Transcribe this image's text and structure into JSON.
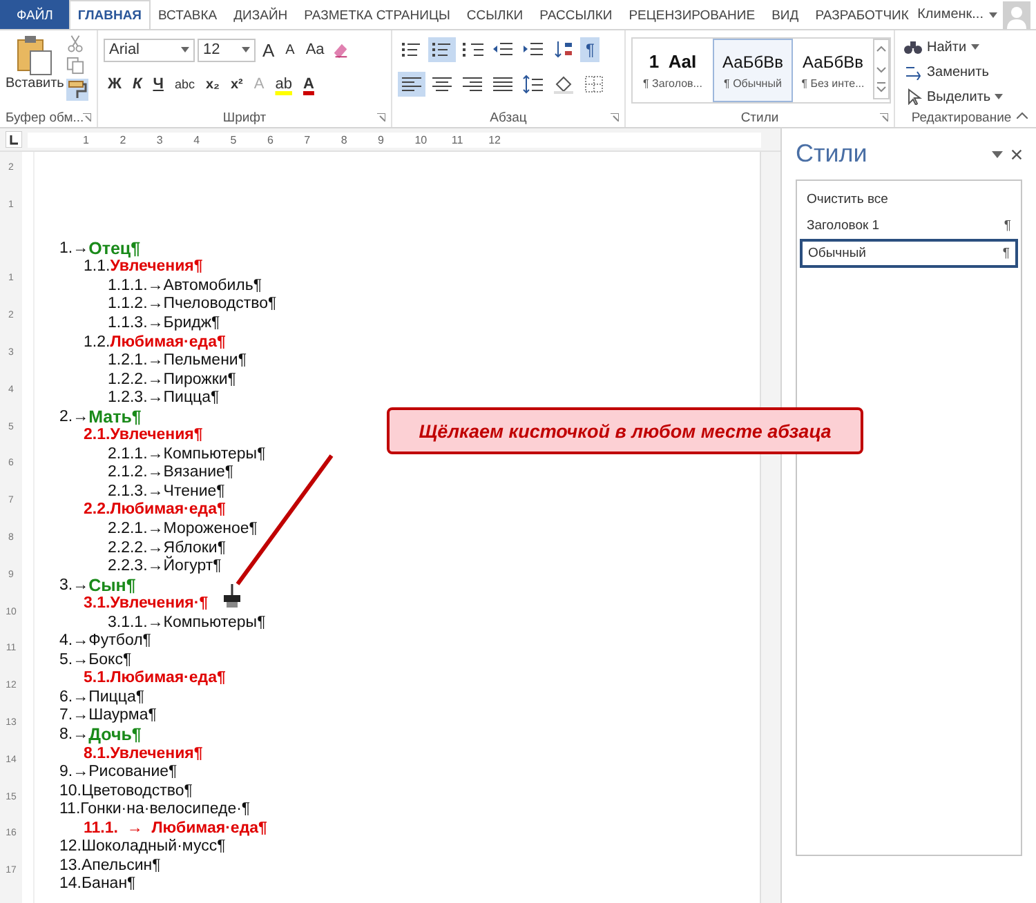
{
  "tabs": [
    {
      "label": "ФАЙЛ",
      "kind": "file",
      "selected": false
    },
    {
      "label": "ГЛАВНАЯ",
      "kind": "tab",
      "selected": true
    },
    {
      "label": "ВСТАВКА",
      "kind": "tab",
      "selected": false
    },
    {
      "label": "ДИЗАЙН",
      "kind": "tab",
      "selected": false
    },
    {
      "label": "РАЗМЕТКА СТРАНИЦЫ",
      "kind": "tab",
      "selected": false
    },
    {
      "label": "ССЫЛКИ",
      "kind": "tab",
      "selected": false
    },
    {
      "label": "РАССЫЛКИ",
      "kind": "tab",
      "selected": false
    },
    {
      "label": "РЕЦЕНЗИРОВАНИЕ",
      "kind": "tab",
      "selected": false
    },
    {
      "label": "ВИД",
      "kind": "tab",
      "selected": false
    },
    {
      "label": "РАЗРАБОТЧИК",
      "kind": "tab",
      "selected": false
    }
  ],
  "user": {
    "name": "Клименк..."
  },
  "clipboard": {
    "label": "Буфер обм...",
    "paste": "Вставить",
    "format_painter_on": true
  },
  "font": {
    "label": "Шрифт",
    "family": "Arial",
    "size": "12",
    "case_button": "Aa",
    "effects_letter": "A",
    "highlight_letters": "ab",
    "color_letter": "A",
    "format_buttons": [
      {
        "kind": "bold",
        "label": "Ж"
      },
      {
        "kind": "italic",
        "label": "К"
      },
      {
        "kind": "underline",
        "label": "Ч"
      },
      {
        "kind": "strike",
        "label": "abc"
      },
      {
        "kind": "sub",
        "label": "x₂"
      },
      {
        "kind": "sup",
        "label": "x²"
      }
    ],
    "size_buttons": [
      {
        "kind": "grow",
        "label": "A"
      },
      {
        "kind": "shrink",
        "label": "A"
      }
    ]
  },
  "paragraph": {
    "label": "Абзац",
    "row_1": [
      {
        "kind": "bullets",
        "selected": false
      },
      {
        "kind": "numbering",
        "selected": true
      },
      {
        "kind": "multilevel",
        "selected": false
      },
      {
        "kind": "outdent",
        "selected": false
      },
      {
        "kind": "indent",
        "selected": false
      },
      {
        "kind": "sort",
        "selected": false
      },
      {
        "kind": "marks",
        "selected": true,
        "label": "¶"
      }
    ],
    "row_2": [
      {
        "kind": "left",
        "selected": true
      },
      {
        "kind": "center",
        "selected": false
      },
      {
        "kind": "right",
        "selected": false
      },
      {
        "kind": "justify",
        "selected": false
      },
      {
        "kind": "spacing",
        "selected": false
      },
      {
        "kind": "shading",
        "selected": false
      },
      {
        "kind": "borders",
        "selected": false
      }
    ]
  },
  "styles": {
    "label": "Стили",
    "gallery": [
      {
        "sample": "1  AaI",
        "name": "¶ Заголов...",
        "kind": "heading",
        "selected": false
      },
      {
        "sample": "АаБбВв",
        "name": "¶ Обычный",
        "kind": "normal",
        "selected": true
      },
      {
        "sample": "АаБбВв",
        "name": "¶ Без инте...",
        "kind": "normal",
        "selected": false
      }
    ]
  },
  "editing": {
    "label": "Редактирование",
    "find": "Найти",
    "replace": "Заменить",
    "select": "Выделить"
  },
  "ruler": {
    "horizontal": [
      "1",
      "2",
      "3",
      "4",
      "5",
      "6",
      "7",
      "8",
      "9",
      "10",
      "11",
      "12"
    ],
    "vertical": [
      "2",
      "1",
      "1",
      "2",
      "3",
      "4",
      "5",
      "6",
      "7",
      "8",
      "9",
      "10",
      "11",
      "12",
      "13",
      "14",
      "15",
      "16",
      "17"
    ]
  },
  "document": [
    {
      "number": "1.→",
      "text": "Отец¶",
      "kind": "person",
      "number_highlighted": false,
      "children": [
        {
          "number": "1.1.",
          "text": "Увлечения¶",
          "kind": "category",
          "number_highlighted": false,
          "children": [
            {
              "number": "1.1.1.→",
              "text": "Автомобиль¶",
              "kind": "item",
              "number_highlighted": false
            },
            {
              "number": "1.1.2.→",
              "text": "Пчеловодство¶",
              "kind": "item",
              "number_highlighted": false
            },
            {
              "number": "1.1.3.→",
              "text": "Бридж¶",
              "kind": "item",
              "number_highlighted": false
            }
          ]
        },
        {
          "number": "1.2.",
          "text": "Любимая·еда¶",
          "kind": "category",
          "number_highlighted": false,
          "children": [
            {
              "number": "1.2.1.→",
              "text": "Пельмени¶",
              "kind": "item",
              "number_highlighted": false
            },
            {
              "number": "1.2.2.→",
              "text": "Пирожки¶",
              "kind": "item",
              "number_highlighted": false
            },
            {
              "number": "1.2.3.→",
              "text": "Пицца¶",
              "kind": "item",
              "number_highlighted": false
            }
          ]
        }
      ]
    },
    {
      "number": "2.→",
      "text": "Мать¶",
      "kind": "person",
      "number_highlighted": false,
      "children": [
        {
          "number": "2.1.",
          "text": "Увлечения¶",
          "kind": "category",
          "number_highlighted": true,
          "children": [
            {
              "number": "2.1.1.→",
              "text": "Компьютеры¶",
              "kind": "item",
              "number_highlighted": false
            },
            {
              "number": "2.1.2.→",
              "text": "Вязание¶",
              "kind": "item",
              "number_highlighted": false
            },
            {
              "number": "2.1.3.→",
              "text": "Чтение¶",
              "kind": "item",
              "number_highlighted": false
            }
          ]
        },
        {
          "number": "2.2.",
          "text": "Любимая·еда¶",
          "kind": "category",
          "number_highlighted": true,
          "children": [
            {
              "number": "2.2.1.→",
              "text": "Мороженое¶",
              "kind": "item",
              "number_highlighted": false
            },
            {
              "number": "2.2.2.→",
              "text": "Яблоки¶",
              "kind": "item",
              "number_highlighted": false
            },
            {
              "number": "2.2.3.→",
              "text": "Йогурт¶",
              "kind": "item",
              "number_highlighted": false
            }
          ]
        }
      ]
    },
    {
      "number": "3.→",
      "text": "Сын¶",
      "kind": "person",
      "number_highlighted": false,
      "children": [
        {
          "number": "3.1.",
          "text": "Увлечения·¶",
          "kind": "category",
          "number_highlighted": true,
          "children": [
            {
              "number": "3.1.1.→",
              "text": "Компьютеры¶",
              "kind": "item",
              "number_highlighted": false
            }
          ]
        }
      ]
    },
    {
      "number": "4.→",
      "text": "Футбол¶",
      "kind": "item",
      "number_highlighted": false
    },
    {
      "number": "5.→",
      "text": "Бокс¶",
      "kind": "item",
      "number_highlighted": false,
      "children": [
        {
          "number": "5.1.",
          "text": "Любимая·еда¶",
          "kind": "category",
          "number_highlighted": true
        }
      ]
    },
    {
      "number": "6.→",
      "text": "Пицца¶",
      "kind": "item",
      "number_highlighted": false
    },
    {
      "number": "7.→",
      "text": "Шаурма¶",
      "kind": "item",
      "number_highlighted": false
    },
    {
      "number": "8.→",
      "text": "Дочь¶",
      "kind": "person",
      "number_highlighted": false,
      "children": [
        {
          "number": "8.1.",
          "text": "Увлечения¶",
          "kind": "category",
          "number_highlighted": true
        }
      ]
    },
    {
      "number": "9.→",
      "text": "Рисование¶",
      "kind": "item",
      "number_highlighted": false
    },
    {
      "number": "10.",
      "text": "Цветоводство¶",
      "kind": "item",
      "number_highlighted": false
    },
    {
      "number": "11.",
      "text": "Гонки·на·велосипеде·¶",
      "kind": "item",
      "number_highlighted": false,
      "children": [
        {
          "number": "11.1.  →  ",
          "text": "Любимая·еда¶",
          "kind": "category",
          "number_highlighted": true
        }
      ]
    },
    {
      "number": "12.",
      "text": "Шоколадный·мусс¶",
      "kind": "item",
      "number_highlighted": false
    },
    {
      "number": "13.",
      "text": "Апельсин¶",
      "kind": "item",
      "number_highlighted": false
    },
    {
      "number": "14.",
      "text": "Банан¶",
      "kind": "item",
      "number_highlighted": false
    }
  ],
  "callout": {
    "text": "Щёлкаем кисточкой в любом месте абзаца"
  },
  "styles_pane": {
    "title": "Стили",
    "items": [
      {
        "label": "Очистить все",
        "selected": false
      },
      {
        "label": "Заголовок 1",
        "mark": "¶",
        "selected": false
      },
      {
        "label": "Обычный",
        "mark": "¶",
        "selected": true
      }
    ]
  }
}
